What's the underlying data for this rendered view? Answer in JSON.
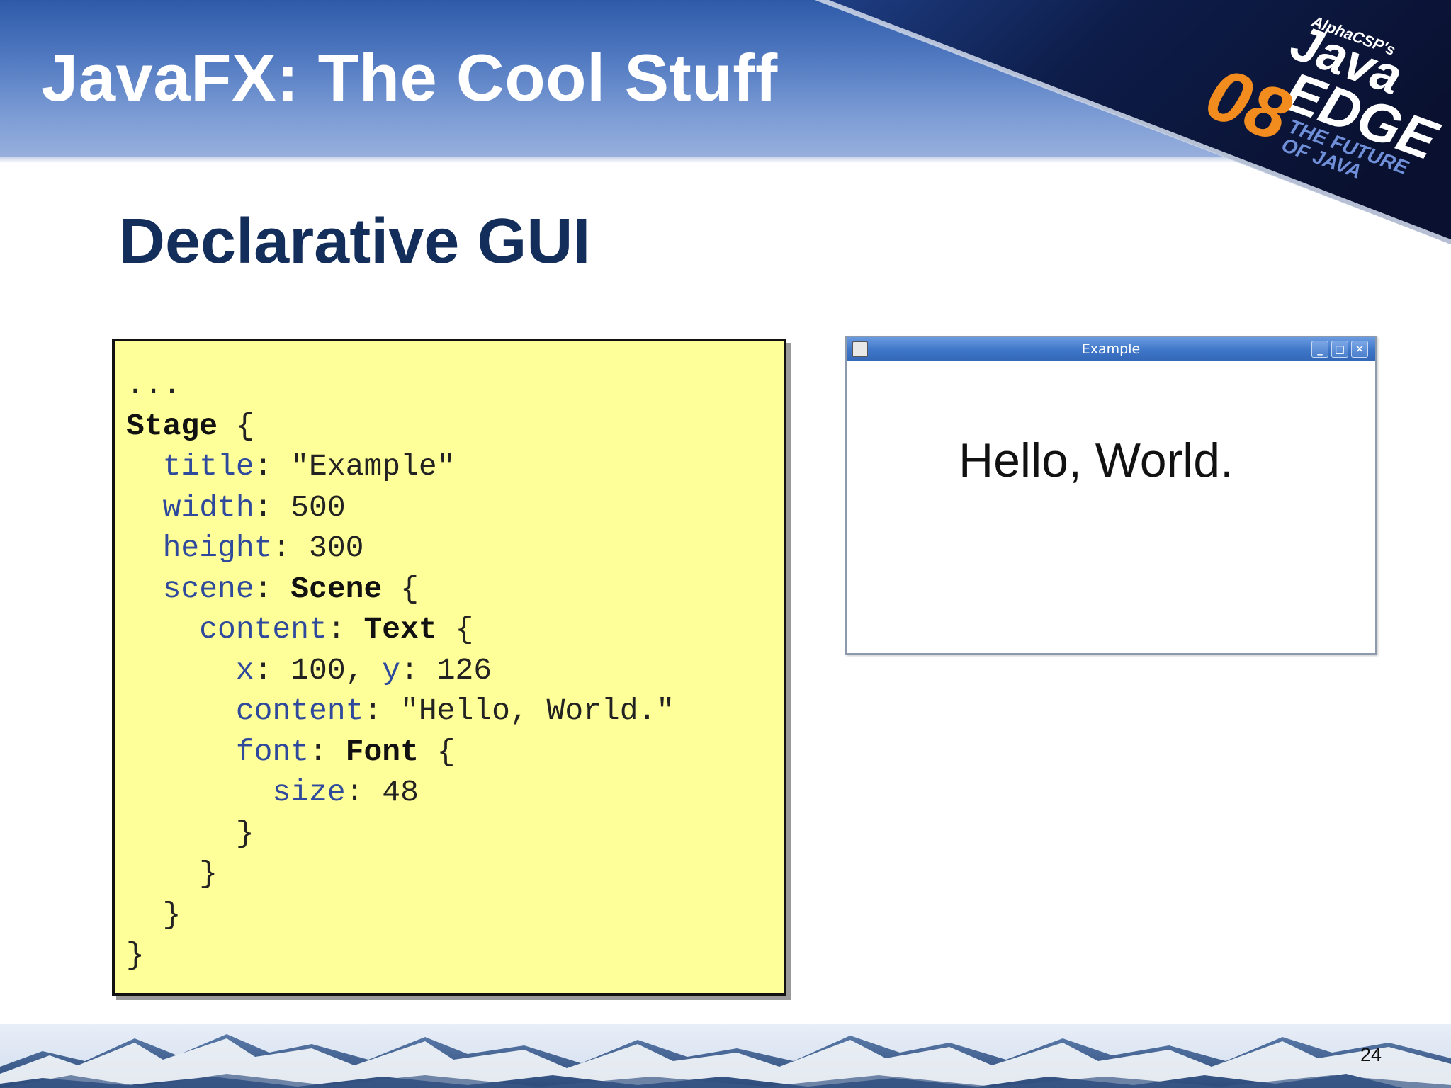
{
  "slide": {
    "title": "JavaFX: The Cool Stuff",
    "heading": "Declarative GUI",
    "page_number": "24"
  },
  "logo": {
    "alpha": "AlphaCSP's",
    "java": "Java",
    "edge": "EDGE",
    "year": "08",
    "tagline_line1": "THE FUTURE",
    "tagline_line2": "OF JAVA"
  },
  "code": {
    "lines": [
      [
        {
          "t": "...",
          "s": "plain"
        }
      ],
      [
        {
          "t": "Stage",
          "s": "kw"
        },
        {
          "t": " {",
          "s": "plain"
        }
      ],
      [
        {
          "t": "  ",
          "s": "plain"
        },
        {
          "t": "title",
          "s": "prop"
        },
        {
          "t": ": \"Example\"",
          "s": "plain"
        }
      ],
      [
        {
          "t": "  ",
          "s": "plain"
        },
        {
          "t": "width",
          "s": "prop"
        },
        {
          "t": ": 500",
          "s": "plain"
        }
      ],
      [
        {
          "t": "  ",
          "s": "plain"
        },
        {
          "t": "height",
          "s": "prop"
        },
        {
          "t": ": 300",
          "s": "plain"
        }
      ],
      [
        {
          "t": "  ",
          "s": "plain"
        },
        {
          "t": "scene",
          "s": "prop"
        },
        {
          "t": ": ",
          "s": "plain"
        },
        {
          "t": "Scene",
          "s": "kw"
        },
        {
          "t": " {",
          "s": "plain"
        }
      ],
      [
        {
          "t": "    ",
          "s": "plain"
        },
        {
          "t": "content",
          "s": "prop"
        },
        {
          "t": ": ",
          "s": "plain"
        },
        {
          "t": "Text",
          "s": "kw"
        },
        {
          "t": " {",
          "s": "plain"
        }
      ],
      [
        {
          "t": "      ",
          "s": "plain"
        },
        {
          "t": "x",
          "s": "prop"
        },
        {
          "t": ": 100, ",
          "s": "plain"
        },
        {
          "t": "y",
          "s": "prop"
        },
        {
          "t": ": 126",
          "s": "plain"
        }
      ],
      [
        {
          "t": "      ",
          "s": "plain"
        },
        {
          "t": "content",
          "s": "prop"
        },
        {
          "t": ": \"Hello, World.\"",
          "s": "plain"
        }
      ],
      [
        {
          "t": "      ",
          "s": "plain"
        },
        {
          "t": "font",
          "s": "prop"
        },
        {
          "t": ": ",
          "s": "plain"
        },
        {
          "t": "Font",
          "s": "kw"
        },
        {
          "t": " {",
          "s": "plain"
        }
      ],
      [
        {
          "t": "        ",
          "s": "plain"
        },
        {
          "t": "size",
          "s": "prop"
        },
        {
          "t": ": 48",
          "s": "plain"
        }
      ],
      [
        {
          "t": "      }",
          "s": "plain"
        }
      ],
      [
        {
          "t": "    }",
          "s": "plain"
        }
      ],
      [
        {
          "t": "  }",
          "s": "plain"
        }
      ],
      [
        {
          "t": "}",
          "s": "plain"
        }
      ]
    ]
  },
  "example_window": {
    "title": "Example",
    "content_text": "Hello, World.",
    "buttons": {
      "minimize": "_",
      "maximize": "□",
      "close": "✕"
    }
  },
  "colors": {
    "heading": "#132e5a",
    "code_background": "#ffff99",
    "code_property": "#2f4a9c",
    "logo_orange": "#f28c1e",
    "logo_navy": "#142a66"
  }
}
